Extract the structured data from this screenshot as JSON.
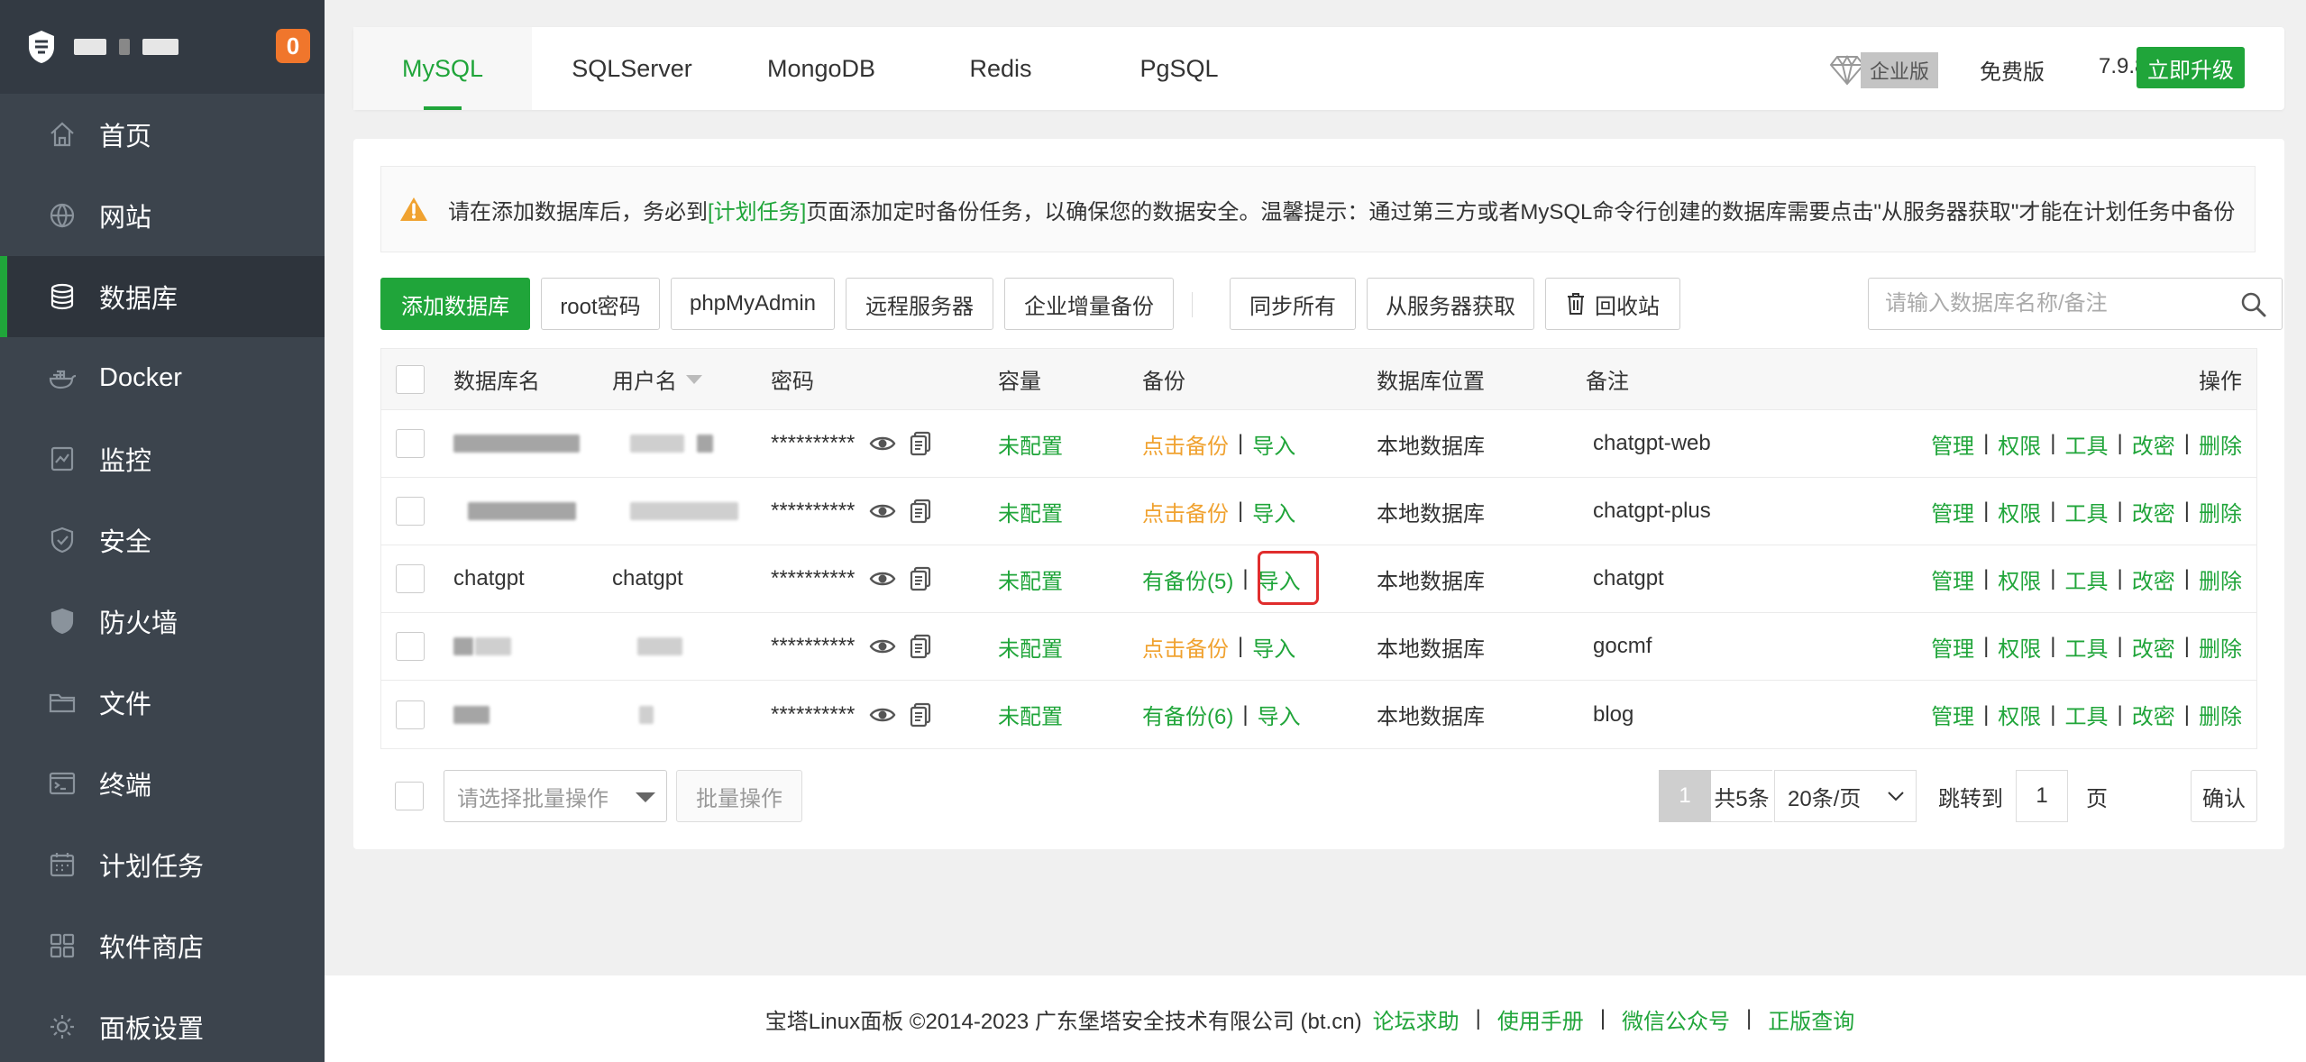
{
  "sidebar": {
    "alert_count": "0",
    "items": [
      {
        "label": "首页",
        "icon": "home-icon"
      },
      {
        "label": "网站",
        "icon": "globe-icon"
      },
      {
        "label": "数据库",
        "icon": "database-icon",
        "active": true
      },
      {
        "label": "Docker",
        "icon": "docker-icon"
      },
      {
        "label": "监控",
        "icon": "monitor-icon"
      },
      {
        "label": "安全",
        "icon": "shield-icon"
      },
      {
        "label": "防火墙",
        "icon": "firewall-icon"
      },
      {
        "label": "文件",
        "icon": "folder-icon"
      },
      {
        "label": "终端",
        "icon": "terminal-icon"
      },
      {
        "label": "计划任务",
        "icon": "calendar-icon"
      },
      {
        "label": "软件商店",
        "icon": "apps-icon"
      },
      {
        "label": "面板设置",
        "icon": "gear-icon"
      }
    ]
  },
  "tabs": [
    "MySQL",
    "SQLServer",
    "MongoDB",
    "Redis",
    "PgSQL"
  ],
  "active_tab": "MySQL",
  "header": {
    "enterprise_label": "企业版",
    "free_label": "免费版",
    "version": "7.9.8",
    "upgrade_label": "立即升级"
  },
  "alert": {
    "prefix": "请在添加数据库后，务必到",
    "link": "[计划任务]",
    "suffix": "页面添加定时备份任务，以确保您的数据安全。温馨提示：通过第三方或者MySQL命令行创建的数据库需要点击\"从服务器获取\"才能在计划任务中备份"
  },
  "toolbar": {
    "add_db": "添加数据库",
    "root_pwd": "root密码",
    "phpmyadmin": "phpMyAdmin",
    "remote_server": "远程服务器",
    "enterprise_backup": "企业增量备份",
    "sync_all": "同步所有",
    "fetch_server": "从服务器获取",
    "recycle_bin": "回收站",
    "search_placeholder": "请输入数据库名称/备注"
  },
  "table": {
    "headers": {
      "name": "数据库名",
      "user": "用户名",
      "password": "密码",
      "capacity": "容量",
      "backup": "备份",
      "location": "数据库位置",
      "note": "备注",
      "actions": "操作"
    },
    "rows": [
      {
        "name": "",
        "user": "",
        "password": "**********",
        "capacity": "未配置",
        "backup": "点击备份",
        "has_backup": false,
        "import": "导入",
        "location": "本地数据库",
        "note": "chatgpt-web"
      },
      {
        "name": "",
        "user": "",
        "password": "**********",
        "capacity": "未配置",
        "backup": "点击备份",
        "has_backup": false,
        "import": "导入",
        "location": "本地数据库",
        "note": "chatgpt-plus"
      },
      {
        "name": "chatgpt",
        "user": "chatgpt",
        "password": "**********",
        "capacity": "未配置",
        "backup": "有备份(5)",
        "has_backup": true,
        "import": "导入",
        "location": "本地数据库",
        "note": "chatgpt",
        "highlighted": true
      },
      {
        "name": "",
        "user": "",
        "password": "**********",
        "capacity": "未配置",
        "backup": "点击备份",
        "has_backup": false,
        "import": "导入",
        "location": "本地数据库",
        "note": "gocmf"
      },
      {
        "name": "",
        "user": "",
        "password": "**********",
        "capacity": "未配置",
        "backup": "有备份(6)",
        "has_backup": true,
        "import": "导入",
        "location": "本地数据库",
        "note": "blog"
      }
    ],
    "row_actions": [
      "管理",
      "权限",
      "工具",
      "改密",
      "删除"
    ]
  },
  "footer_bar": {
    "batch_placeholder": "请选择批量操作",
    "batch_button": "批量操作",
    "current_page": "1",
    "total": "共5条",
    "page_size": "20条/页",
    "jump_label": "跳转到",
    "jump_value": "1",
    "page_unit": "页",
    "confirm": "确认"
  },
  "page_footer": {
    "copyright": "宝塔Linux面板 ©2014-2023 广东堡塔安全技术有限公司 (bt.cn)",
    "links": [
      "论坛求助",
      "使用手册",
      "微信公众号",
      "正版查询"
    ]
  },
  "colors": {
    "brand_green": "#20a53a",
    "sidebar_bg": "#3c444d",
    "backup_orange": "#f0a230",
    "badge_orange": "#f0762c",
    "highlight_red": "#e02d2d"
  }
}
